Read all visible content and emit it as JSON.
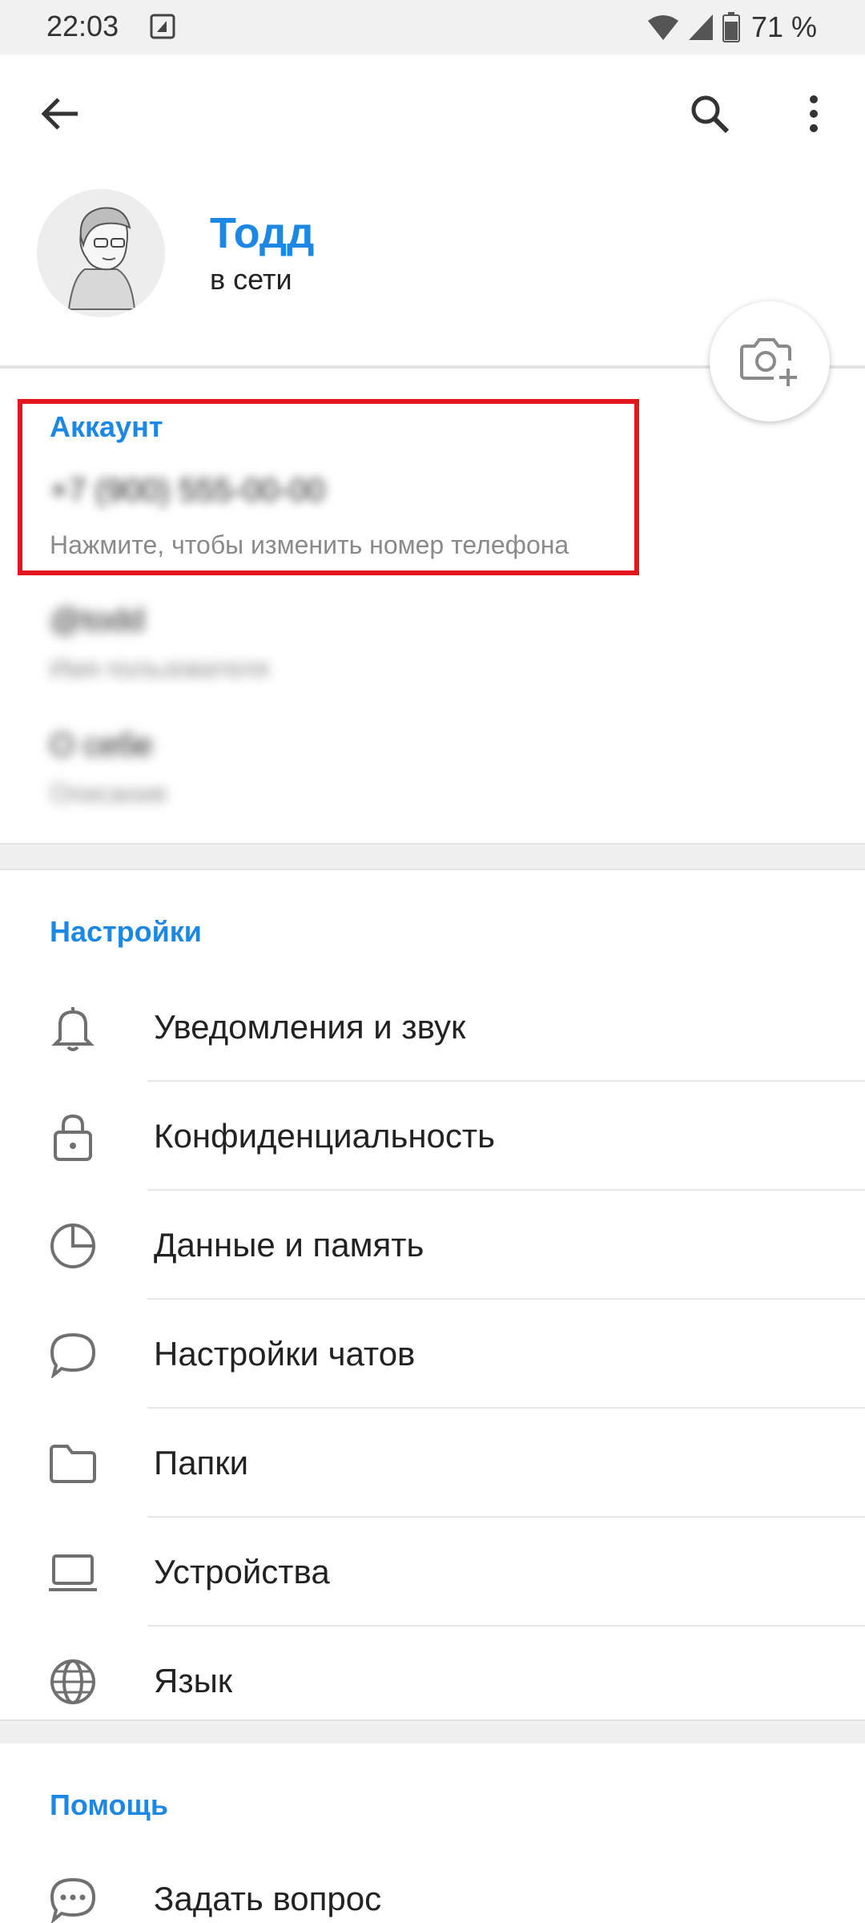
{
  "status_bar": {
    "time": "22:03",
    "battery_percent": "71 %",
    "icons": [
      "notification-icon",
      "wifi-icon",
      "signal-icon",
      "battery-icon"
    ]
  },
  "toolbar": {
    "back_icon": "arrow-back-icon",
    "search_icon": "search-icon",
    "more_icon": "more-vert-icon"
  },
  "profile": {
    "name": "Тодд",
    "status": "в сети",
    "camera_icon": "add-photo-icon"
  },
  "account": {
    "title": "Аккаунт",
    "phone": "+7 (900) 555-00-00",
    "phone_hint": "Нажмите, чтобы изменить номер телефона",
    "username": "@todd",
    "username_hint": "Имя пользователя",
    "bio": "О себе",
    "bio_hint": "Описание"
  },
  "settings": {
    "title": "Настройки",
    "items": [
      {
        "label": "Уведомления и звук",
        "icon": "bell-icon"
      },
      {
        "label": "Конфиденциальность",
        "icon": "lock-icon"
      },
      {
        "label": "Данные и память",
        "icon": "pie-chart-icon"
      },
      {
        "label": "Настройки чатов",
        "icon": "chat-bubble-icon"
      },
      {
        "label": "Папки",
        "icon": "folder-icon"
      },
      {
        "label": "Устройства",
        "icon": "laptop-icon"
      },
      {
        "label": "Язык",
        "icon": "globe-icon"
      }
    ]
  },
  "help": {
    "title": "Помощь",
    "items": [
      {
        "label": "Задать вопрос",
        "icon": "question-chat-icon"
      }
    ]
  },
  "colors": {
    "accent": "#1d88e4",
    "highlight": "#e4141c"
  }
}
